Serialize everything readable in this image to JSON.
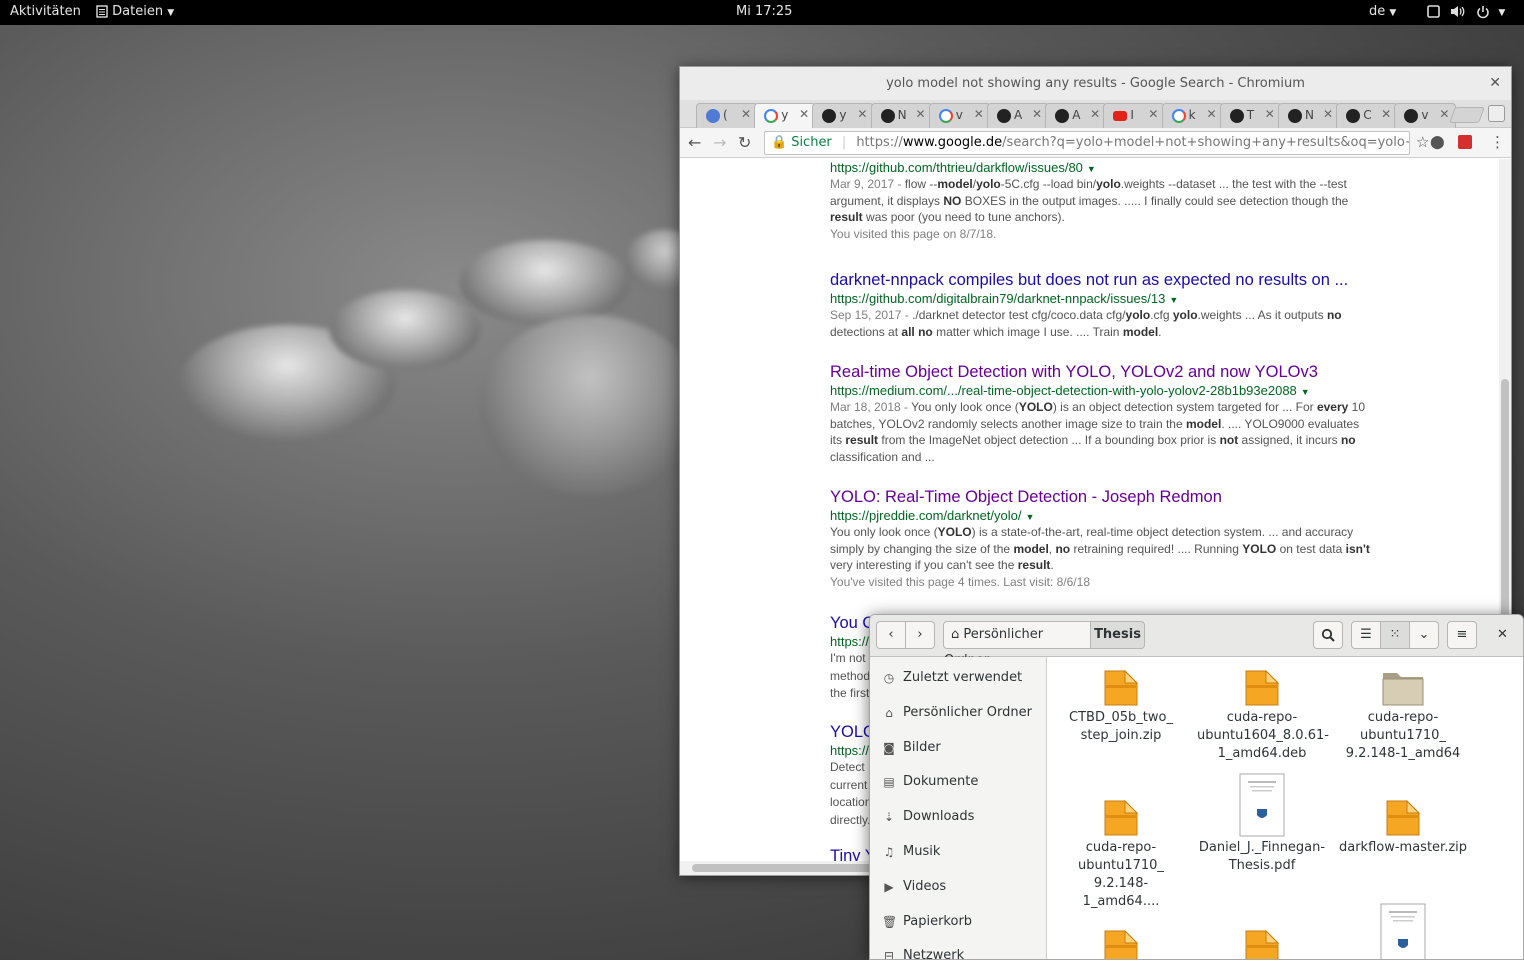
{
  "topbar": {
    "activities": "Aktivitäten",
    "app_menu": "Dateien",
    "clock": "Mi 17:25",
    "keyboard_layout": "de"
  },
  "chromium": {
    "window_title": "yolo model not showing any results - Google Search - Chromium",
    "tabs": [
      {
        "letter": "(",
        "icon": "chromium-icon",
        "active": false
      },
      {
        "letter": "y",
        "icon": "google-icon",
        "active": true
      },
      {
        "letter": "y",
        "icon": "github-icon",
        "active": false
      },
      {
        "letter": "N",
        "icon": "github-icon",
        "active": false
      },
      {
        "letter": "v",
        "icon": "google-icon",
        "active": false
      },
      {
        "letter": "A",
        "icon": "github-icon",
        "active": false
      },
      {
        "letter": "A",
        "icon": "github-icon",
        "active": false
      },
      {
        "letter": "I",
        "icon": "youtube-icon",
        "active": false
      },
      {
        "letter": "k",
        "icon": "google-icon",
        "active": false
      },
      {
        "letter": "T",
        "icon": "github-icon",
        "active": false
      },
      {
        "letter": "N",
        "icon": "github-icon",
        "active": false
      },
      {
        "letter": "C",
        "icon": "github-icon",
        "active": false
      },
      {
        "letter": "v",
        "icon": "github-icon",
        "active": false
      }
    ],
    "omnibox": {
      "secure_label": "Sicher",
      "url_prefix": "https://",
      "url_domain": "www.google.de",
      "url_rest": "/search?q=yolo+model+not+showing+any+results&oq=yolo+model+n..."
    },
    "results": [
      {
        "title": "",
        "url": "https://github.com/thtrieu/darkflow/issues/80",
        "date": "Mar 9, 2017 - ",
        "snippet_html": "flow --<b>model</b>/<b>yolo</b>-5C.cfg --load bin/<b>yolo</b>.weights --dataset ... the test with the --test argument, it displays <b>NO</b> BOXES in the output images. ..... I finally could see detection though the <b>result</b> was poor (you need to tune anchors).",
        "visited": "You visited this page on 8/7/18."
      },
      {
        "title": "darknet-nnpack compiles but does not run as expected no results on ...",
        "url": "https://github.com/digitalbrain79/darknet-nnpack/issues/13",
        "date": "Sep 15, 2017 - ",
        "snippet_html": "./darknet detector test cfg/coco.data cfg/<b>yolo</b>.cfg <b>yolo</b>.weights ... As it outputs <b>no</b> detections at <b>all no</b> matter which image I use. .... Train <b>model</b>.",
        "visited": ""
      },
      {
        "title": "Real-time Object Detection with YOLO, YOLOv2 and now YOLOv3",
        "url": "https://medium.com/.../real-time-object-detection-with-yolo-yolov2-28b1b93e2088",
        "date": "Mar 18, 2018 - ",
        "snippet_html": "You only look once (<b>YOLO</b>) is an object detection system targeted for ... For <b>every</b> 10 batches, YOLOv2 randomly selects another image size to train the <b>model</b>. .... YOLO9000 evaluates its <b>result</b> from the ImageNet object detection ... If a bounding box prior is <b>not</b> assigned, it incurs <b>no</b> classification and ...",
        "visited": ""
      },
      {
        "title": "YOLO: Real-Time Object Detection - Joseph Redmon",
        "url": "https://pjreddie.com/darknet/yolo/",
        "date": "",
        "snippet_html": "You only look once (<b>YOLO</b>) is a state-of-the-art, real-time object detection system. ... and accuracy simply by changing the size of the <b>model</b>, <b>no</b> retraining required! .... Running <b>YOLO</b> on test data <b>isn't</b> very interesting if you can't see the <b>result</b>.",
        "visited": "You've visited this page 4 times. Last visit: 8/6/18"
      }
    ],
    "partial": {
      "r5_title": "You O",
      "r5_url": "https://",
      "r5_lines": [
        "I'm not",
        "method",
        "the first"
      ],
      "r6_title": "YOLO",
      "r6_url": "https://",
      "r6_lines": [
        "Detect",
        "current",
        "location",
        "directly."
      ],
      "r7_title": "Tiny Y"
    }
  },
  "files": {
    "breadcrumb_home": "Persönlicher Ordner",
    "breadcrumb_current": "Thesis",
    "sidebar": [
      {
        "label": "Zuletzt verwendet",
        "icon": "clock-icon",
        "glyph": "◷"
      },
      {
        "label": "Persönlicher Ordner",
        "icon": "home-icon",
        "glyph": "⌂"
      },
      {
        "label": "Bilder",
        "icon": "camera-icon",
        "glyph": "◙"
      },
      {
        "label": "Dokumente",
        "icon": "document-icon",
        "glyph": "▤"
      },
      {
        "label": "Downloads",
        "icon": "download-icon",
        "glyph": "⇣"
      },
      {
        "label": "Musik",
        "icon": "music-icon",
        "glyph": "♫"
      },
      {
        "label": "Videos",
        "icon": "video-icon",
        "glyph": "▶"
      },
      {
        "label": "Papierkorb",
        "icon": "trash-icon",
        "glyph": "🗑"
      },
      {
        "label": "Netzwerk",
        "icon": "network-icon",
        "glyph": "⊟"
      }
    ],
    "items": [
      {
        "name": "CTBD_05b_two_\nstep_join.zip",
        "type": "zip"
      },
      {
        "name": "cuda-repo-\nubuntu1604_8.0.61-\n1_amd64.deb",
        "type": "zip"
      },
      {
        "name": "cuda-repo-\nubuntu1710_\n9.2.148-1_amd64",
        "type": "folder"
      },
      {
        "name": "cuda-repo-\nubuntu1710_\n9.2.148-1_amd64....",
        "type": "zip"
      },
      {
        "name": "Daniel_J._Finnegan-\nThesis.pdf",
        "type": "pdf"
      },
      {
        "name": "darkflow-master.zip",
        "type": "zip"
      },
      {
        "name": "",
        "type": "zip"
      },
      {
        "name": "",
        "type": "zip"
      },
      {
        "name": "",
        "type": "pdf"
      }
    ]
  }
}
